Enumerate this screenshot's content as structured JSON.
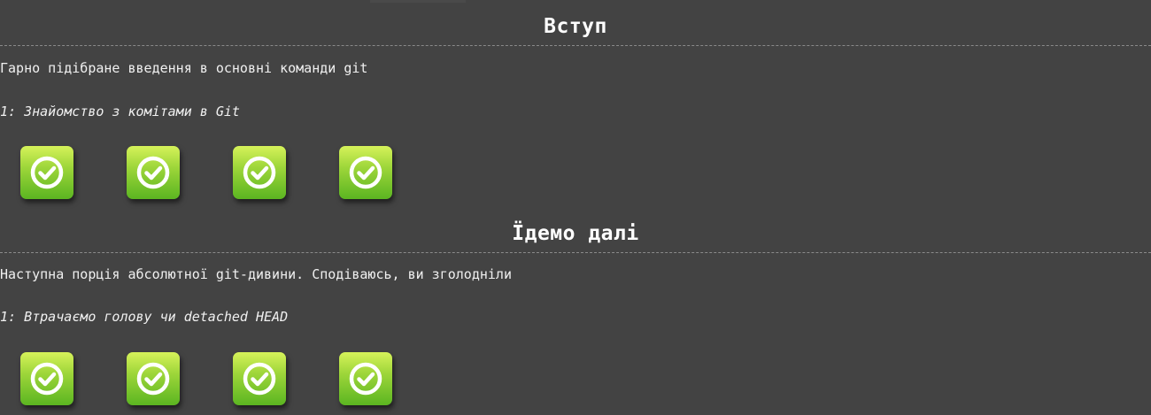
{
  "sections": [
    {
      "title": "Вступ",
      "description": "Гарно підібране введення в основні команди git",
      "level_label": "1: Знайомство з комітами в Git",
      "levels": [
        {
          "icon": "check-icon",
          "status": "completed"
        },
        {
          "icon": "check-icon",
          "status": "completed"
        },
        {
          "icon": "check-icon",
          "status": "completed"
        },
        {
          "icon": "check-icon",
          "status": "completed"
        }
      ]
    },
    {
      "title": "Їдемо далі",
      "description": "Наступна порція абсолютної git-дивини. Сподіваюсь, ви зголодніли",
      "level_label": "1: Втрачаємо голову чи detached HEAD",
      "levels": [
        {
          "icon": "check-icon",
          "status": "completed"
        },
        {
          "icon": "check-icon",
          "status": "completed"
        },
        {
          "icon": "check-icon",
          "status": "completed"
        },
        {
          "icon": "check-icon",
          "status": "completed"
        }
      ]
    }
  ],
  "colors": {
    "background": "#434343",
    "text": "#f0f0f0",
    "completed_green": "#5bb521",
    "completed_light": "#d6f25a"
  }
}
